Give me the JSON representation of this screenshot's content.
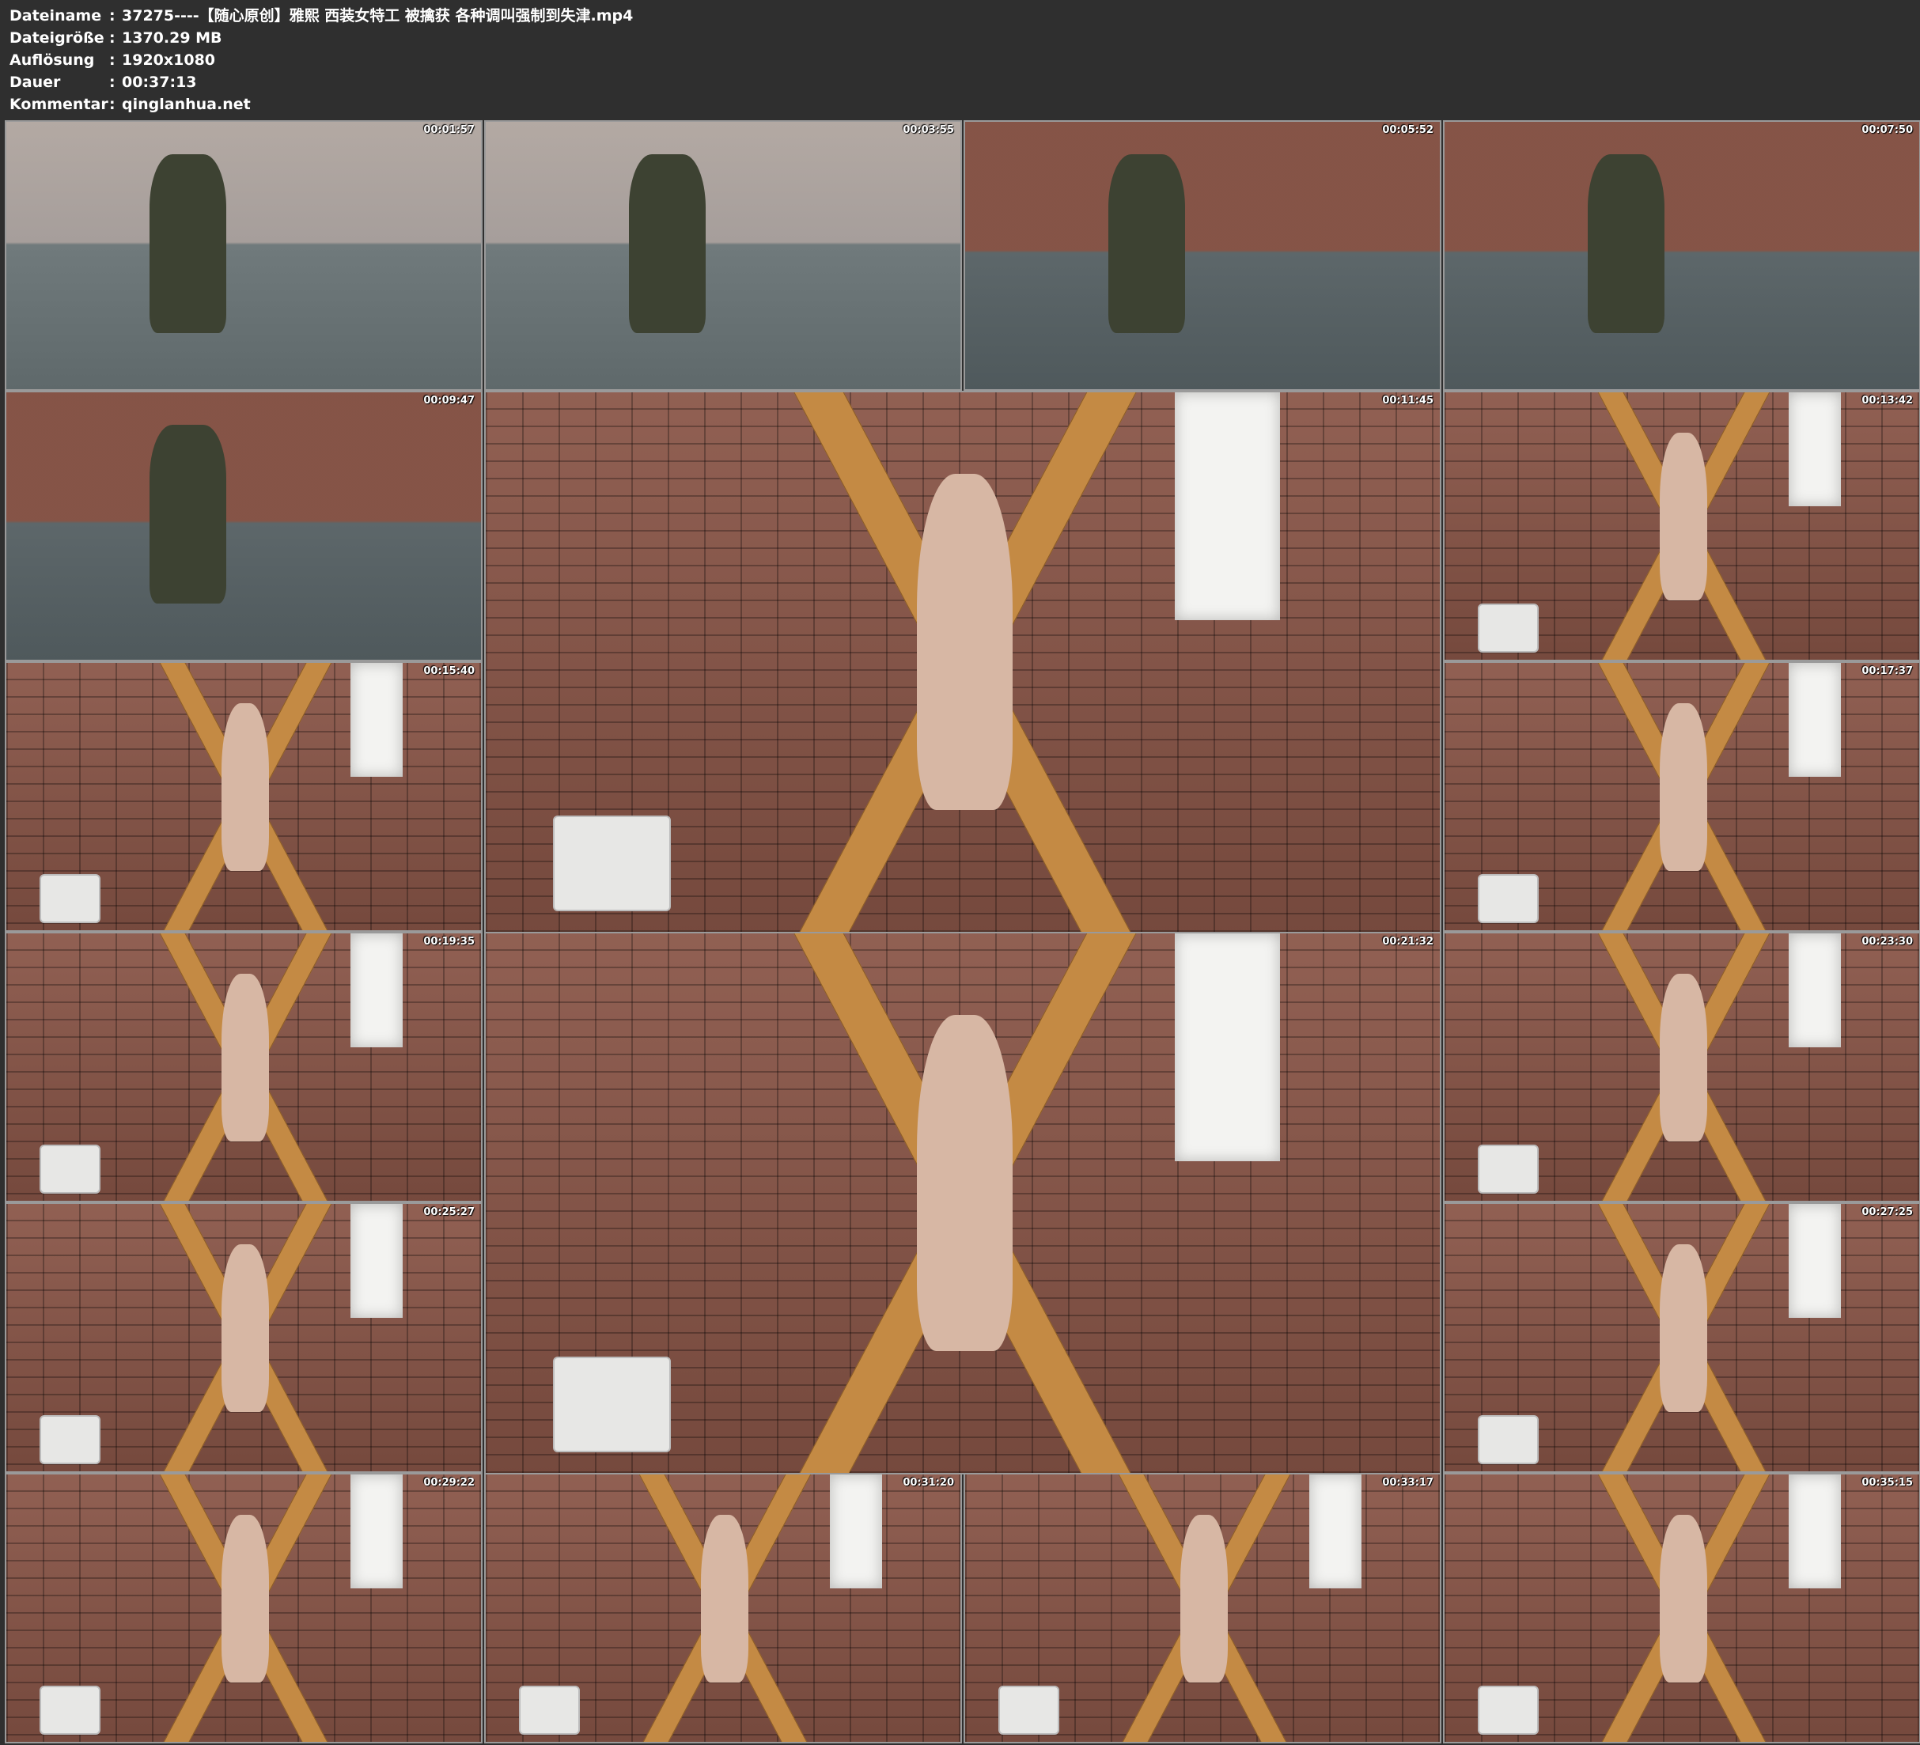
{
  "info": {
    "labels": {
      "filename": "Dateiname",
      "filesize": "Dateigröße",
      "resolution": "Auflösung",
      "duration": "Dauer",
      "comment": "Kommentar"
    },
    "separator": ":",
    "values": {
      "filename": "37275----【随心原创】雅熙 西装女特工 被擒获 各种调叫强制到失津.mp4",
      "filesize": "1370.29 MB",
      "resolution": "1920x1080",
      "duration": "00:37:13",
      "comment": "qinglanhua.net"
    }
  },
  "thumbnails": [
    {
      "timestamp": "00:01:57",
      "scene": "room"
    },
    {
      "timestamp": "00:03:55",
      "scene": "room"
    },
    {
      "timestamp": "00:05:52",
      "scene": "room-brick"
    },
    {
      "timestamp": "00:07:50",
      "scene": "room-brick"
    },
    {
      "timestamp": "00:09:47",
      "scene": "room-brick"
    },
    {
      "timestamp": "00:11:45",
      "scene": "brick"
    },
    {
      "timestamp": "00:13:42",
      "scene": "brick"
    },
    {
      "timestamp": "00:15:40",
      "scene": "brick"
    },
    {
      "timestamp": "00:17:37",
      "scene": "brick"
    },
    {
      "timestamp": "00:19:35",
      "scene": "brick"
    },
    {
      "timestamp": "00:21:32",
      "scene": "brick"
    },
    {
      "timestamp": "00:23:30",
      "scene": "brick"
    },
    {
      "timestamp": "00:25:27",
      "scene": "brick"
    },
    {
      "timestamp": "00:27:25",
      "scene": "brick"
    },
    {
      "timestamp": "00:29:22",
      "scene": "brick"
    },
    {
      "timestamp": "00:31:20",
      "scene": "brick"
    },
    {
      "timestamp": "00:33:17",
      "scene": "brick"
    },
    {
      "timestamp": "00:35:15",
      "scene": "brick"
    }
  ]
}
